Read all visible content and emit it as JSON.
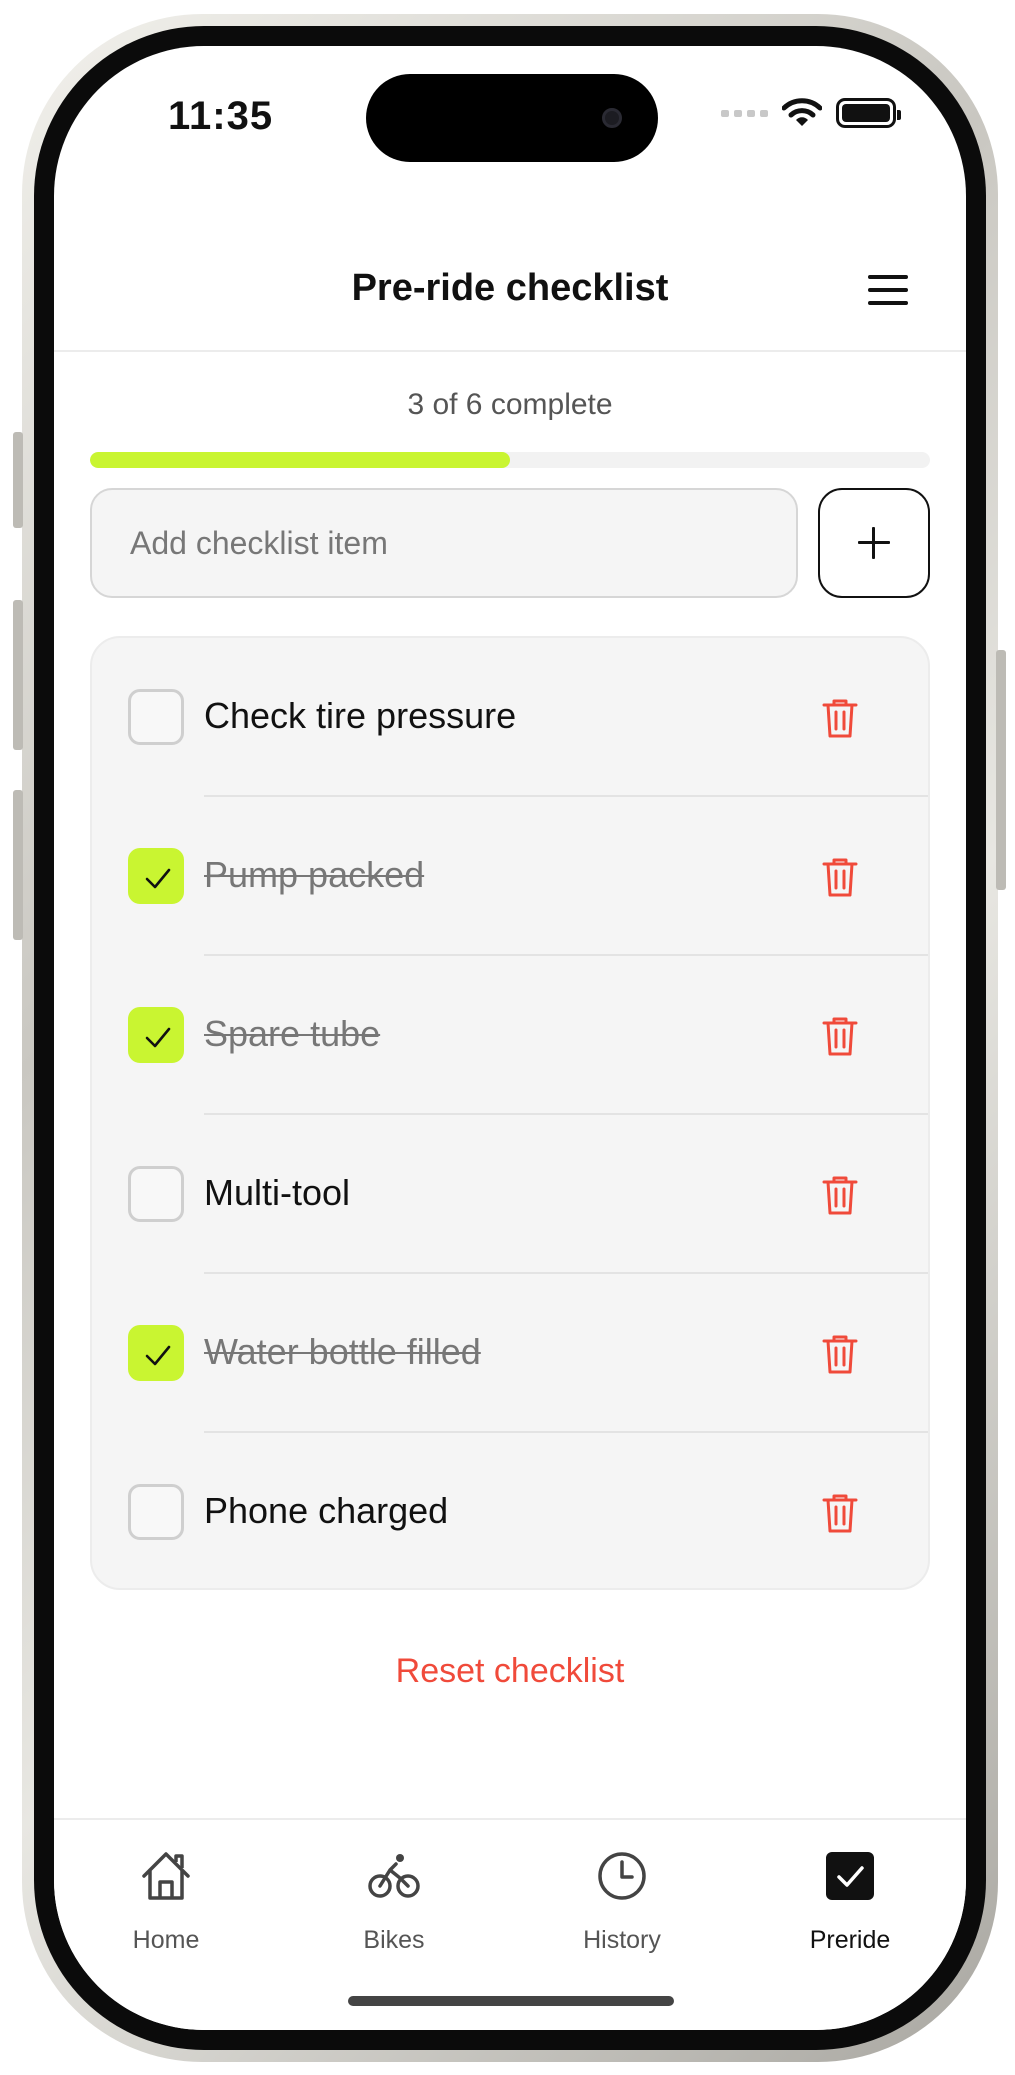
{
  "status_bar": {
    "time": "11:35"
  },
  "header": {
    "title": "Pre-ride checklist"
  },
  "progress": {
    "text": "3 of 6 complete",
    "completed": 3,
    "total": 6,
    "fraction": 0.5
  },
  "add_item": {
    "placeholder": "Add checklist item",
    "value": ""
  },
  "checklist": {
    "items": [
      {
        "label": "Check tire pressure",
        "checked": false
      },
      {
        "label": "Pump packed",
        "checked": true
      },
      {
        "label": "Spare tube",
        "checked": true
      },
      {
        "label": "Multi-tool",
        "checked": false
      },
      {
        "label": "Water bottle filled",
        "checked": true
      },
      {
        "label": "Phone charged",
        "checked": false
      }
    ]
  },
  "reset_label": "Reset checklist",
  "tabs": [
    {
      "label": "Home",
      "icon": "home-icon",
      "active": false
    },
    {
      "label": "Bikes",
      "icon": "bike-icon",
      "active": false
    },
    {
      "label": "History",
      "icon": "clock-icon",
      "active": false
    },
    {
      "label": "Preride",
      "icon": "checkbox-icon",
      "active": true
    }
  ],
  "colors": {
    "accent": "#c9f531",
    "danger": "#f04a3a",
    "text": "#111111",
    "muted": "#777777"
  }
}
